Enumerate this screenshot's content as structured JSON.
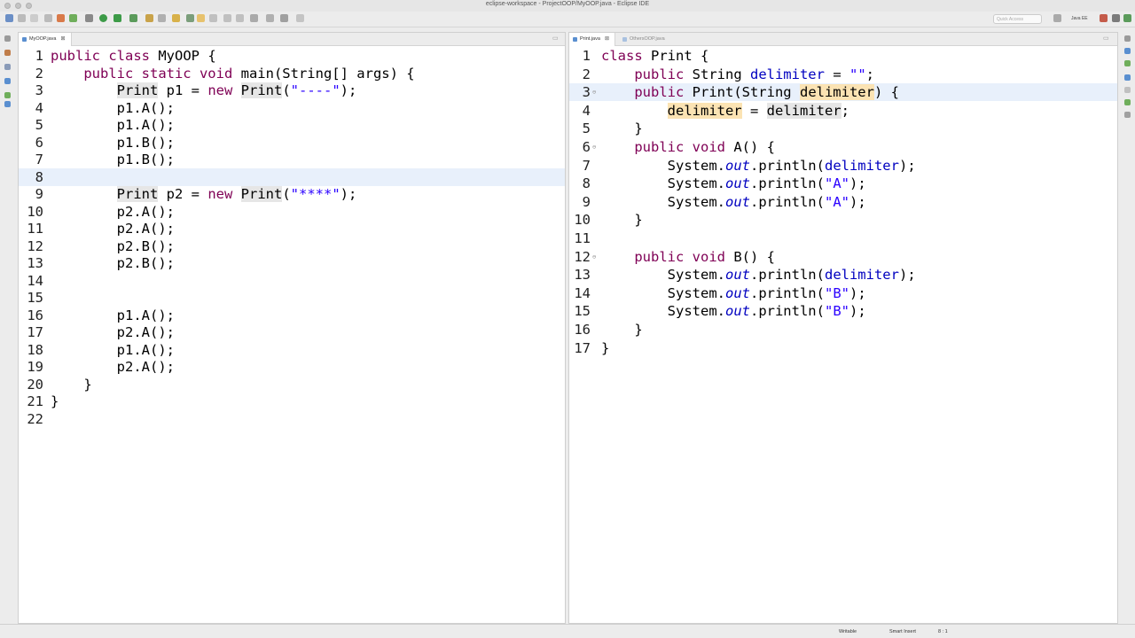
{
  "window": {
    "title": "eclipse-workspace - ProjectOOP/MyOOP.java - Eclipse IDE"
  },
  "toolbar": {
    "quick_access": "Quick Access",
    "perspective": "Java EE"
  },
  "left_editor": {
    "tab": "MyOOP.java",
    "lines": [
      {
        "n": "1",
        "parts": [
          {
            "t": "public class ",
            "c": "kw"
          },
          {
            "t": "MyOOP {"
          }
        ]
      },
      {
        "n": "2",
        "parts": [
          {
            "t": "    "
          },
          {
            "t": "public static void ",
            "c": "kw"
          },
          {
            "t": "main(String[] args) {"
          }
        ]
      },
      {
        "n": "3",
        "parts": [
          {
            "t": "        "
          },
          {
            "t": "Print",
            "c": "ref"
          },
          {
            "t": " p1 = "
          },
          {
            "t": "new ",
            "c": "kw"
          },
          {
            "t": "Print",
            "c": "ref"
          },
          {
            "t": "("
          },
          {
            "t": "\"----\"",
            "c": "str"
          },
          {
            "t": ");"
          }
        ]
      },
      {
        "n": "4",
        "parts": [
          {
            "t": "        p1.A();"
          }
        ]
      },
      {
        "n": "5",
        "parts": [
          {
            "t": "        p1.A();"
          }
        ]
      },
      {
        "n": "6",
        "parts": [
          {
            "t": "        p1.B();"
          }
        ]
      },
      {
        "n": "7",
        "parts": [
          {
            "t": "        p1.B();"
          }
        ]
      },
      {
        "n": "8",
        "parts": [],
        "current": true
      },
      {
        "n": "9",
        "parts": [
          {
            "t": "        "
          },
          {
            "t": "Print",
            "c": "ref"
          },
          {
            "t": " p2 = "
          },
          {
            "t": "new ",
            "c": "kw"
          },
          {
            "t": "Print",
            "c": "ref"
          },
          {
            "t": "("
          },
          {
            "t": "\"****\"",
            "c": "str"
          },
          {
            "t": ");"
          }
        ]
      },
      {
        "n": "10",
        "parts": [
          {
            "t": "        p2.A();"
          }
        ]
      },
      {
        "n": "11",
        "parts": [
          {
            "t": "        p2.A();"
          }
        ]
      },
      {
        "n": "12",
        "parts": [
          {
            "t": "        p2.B();"
          }
        ]
      },
      {
        "n": "13",
        "parts": [
          {
            "t": "        p2.B();"
          }
        ]
      },
      {
        "n": "14",
        "parts": []
      },
      {
        "n": "15",
        "parts": []
      },
      {
        "n": "16",
        "parts": [
          {
            "t": "        p1.A();"
          }
        ]
      },
      {
        "n": "17",
        "parts": [
          {
            "t": "        p2.A();"
          }
        ]
      },
      {
        "n": "18",
        "parts": [
          {
            "t": "        p1.A();"
          }
        ]
      },
      {
        "n": "19",
        "parts": [
          {
            "t": "        p2.A();"
          }
        ]
      },
      {
        "n": "20",
        "parts": [
          {
            "t": "    }"
          }
        ]
      },
      {
        "n": "21",
        "parts": [
          {
            "t": "}"
          }
        ]
      },
      {
        "n": "22",
        "parts": []
      }
    ]
  },
  "right_editor": {
    "tab": "Print.java",
    "tab2": "OthersOOP.java",
    "lines": [
      {
        "n": "1",
        "parts": [
          {
            "t": "class ",
            "c": "kw"
          },
          {
            "t": "Print {"
          }
        ]
      },
      {
        "n": "2",
        "parts": [
          {
            "t": "    "
          },
          {
            "t": "public ",
            "c": "kw"
          },
          {
            "t": "String "
          },
          {
            "t": "delimiter",
            "c": "field"
          },
          {
            "t": " = "
          },
          {
            "t": "\"\"",
            "c": "str"
          },
          {
            "t": ";"
          }
        ]
      },
      {
        "n": "3",
        "parts": [
          {
            "t": "    "
          },
          {
            "t": "public ",
            "c": "kw"
          },
          {
            "t": "Print(String "
          },
          {
            "t": "delimiter",
            "c": "hl"
          },
          {
            "t": ") {"
          }
        ],
        "fold": true,
        "current": true
      },
      {
        "n": "4",
        "parts": [
          {
            "t": "        "
          },
          {
            "t": "delimiter",
            "c": "hl"
          },
          {
            "t": " = "
          },
          {
            "t": "delimiter",
            "c": "ref"
          },
          {
            "t": ";"
          }
        ]
      },
      {
        "n": "5",
        "parts": [
          {
            "t": "    }"
          }
        ]
      },
      {
        "n": "6",
        "parts": [
          {
            "t": "    "
          },
          {
            "t": "public void ",
            "c": "kw"
          },
          {
            "t": "A() {"
          }
        ],
        "fold": true
      },
      {
        "n": "7",
        "parts": [
          {
            "t": "        System."
          },
          {
            "t": "out",
            "c": "stat"
          },
          {
            "t": ".println("
          },
          {
            "t": "delimiter",
            "c": "field"
          },
          {
            "t": ");"
          }
        ]
      },
      {
        "n": "8",
        "parts": [
          {
            "t": "        System."
          },
          {
            "t": "out",
            "c": "stat"
          },
          {
            "t": ".println("
          },
          {
            "t": "\"A\"",
            "c": "str"
          },
          {
            "t": ");"
          }
        ]
      },
      {
        "n": "9",
        "parts": [
          {
            "t": "        System."
          },
          {
            "t": "out",
            "c": "stat"
          },
          {
            "t": ".println("
          },
          {
            "t": "\"A\"",
            "c": "str"
          },
          {
            "t": ");"
          }
        ]
      },
      {
        "n": "10",
        "parts": [
          {
            "t": "    }"
          }
        ]
      },
      {
        "n": "11",
        "parts": []
      },
      {
        "n": "12",
        "parts": [
          {
            "t": "    "
          },
          {
            "t": "public void ",
            "c": "kw"
          },
          {
            "t": "B() {"
          }
        ],
        "fold": true
      },
      {
        "n": "13",
        "parts": [
          {
            "t": "        System."
          },
          {
            "t": "out",
            "c": "stat"
          },
          {
            "t": ".println("
          },
          {
            "t": "delimiter",
            "c": "field"
          },
          {
            "t": ");"
          }
        ]
      },
      {
        "n": "14",
        "parts": [
          {
            "t": "        System."
          },
          {
            "t": "out",
            "c": "stat"
          },
          {
            "t": ".println("
          },
          {
            "t": "\"B\"",
            "c": "str"
          },
          {
            "t": ");"
          }
        ]
      },
      {
        "n": "15",
        "parts": [
          {
            "t": "        System."
          },
          {
            "t": "out",
            "c": "stat"
          },
          {
            "t": ".println("
          },
          {
            "t": "\"B\"",
            "c": "str"
          },
          {
            "t": ");"
          }
        ]
      },
      {
        "n": "16",
        "parts": [
          {
            "t": "    }"
          }
        ]
      },
      {
        "n": "17",
        "parts": [
          {
            "t": "}"
          }
        ]
      }
    ]
  },
  "statusbar": {
    "writable": "Writable",
    "insert_mode": "Smart Insert",
    "position": "8 : 1"
  }
}
